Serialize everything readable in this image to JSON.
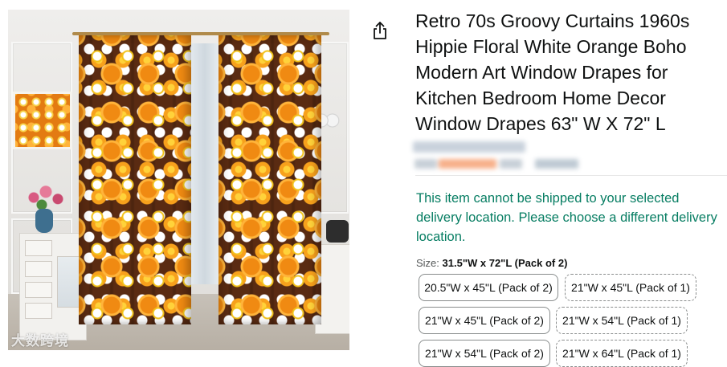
{
  "product": {
    "title": "Retro 70s Groovy Curtains 1960s Hippie Floral White Orange Boho Modern Art Window Drapes for Kitchen Bedroom Home Decor Window Drapes 63\" W X 72\" L",
    "image_watermark": "大数跨境"
  },
  "share": {
    "icon": "share-icon"
  },
  "shipping": {
    "message": "This item cannot be shipped to your selected delivery location. Please choose a different delivery location."
  },
  "size": {
    "label": "Size:",
    "selected": "31.5\"W x 72\"L (Pack of 2)",
    "options": [
      {
        "label": "20.5\"W x 45\"L (Pack of 2)",
        "available": true
      },
      {
        "label": "21\"W x 45\"L (Pack of 1)",
        "available": false
      },
      {
        "label": "21\"W x 45\"L (Pack of 2)",
        "available": true
      },
      {
        "label": "21\"W x 54\"L (Pack of 1)",
        "available": false
      },
      {
        "label": "21\"W x 54\"L (Pack of 2)",
        "available": true
      },
      {
        "label": "21\"W x 64\"L (Pack of 1)",
        "available": false
      }
    ]
  },
  "colors": {
    "shipping_message": "#067d62",
    "title_text": "#0f1111",
    "muted_text": "#565959"
  }
}
